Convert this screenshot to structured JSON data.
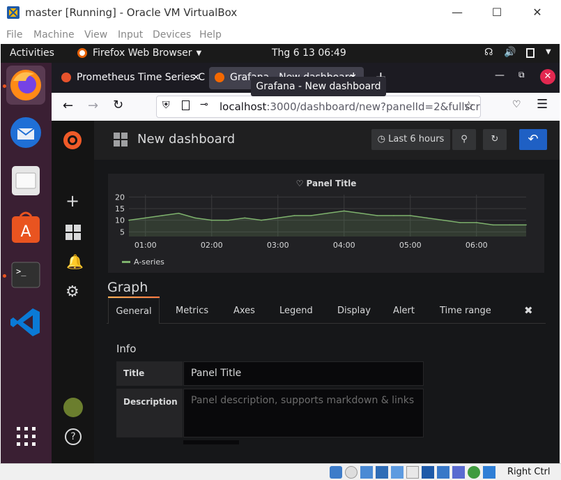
{
  "vbox": {
    "title": "master [Running] - Oracle VM VirtualBox",
    "menu": [
      "File",
      "Machine",
      "View",
      "Input",
      "Devices",
      "Help"
    ],
    "host_key": "Right Ctrl"
  },
  "gnome": {
    "activities": "Activities",
    "app_name": "Firefox Web Browser",
    "clock": "Thg 6 13  06:49"
  },
  "firefox": {
    "tabs": [
      {
        "label": "Prometheus Time Series C"
      },
      {
        "label": "Grafana - New dashboard"
      }
    ],
    "tooltip": "Grafana - New dashboard",
    "url_host": "localhost",
    "url_rest": ":3000/dashboard/new?panelId=2&fullscr"
  },
  "grafana": {
    "dashboard_title": "New dashboard",
    "time_range": "Last 6 hours",
    "panel_title": "Panel Title",
    "editor_title": "Graph",
    "tabs": [
      "General",
      "Metrics",
      "Axes",
      "Legend",
      "Display",
      "Alert",
      "Time range"
    ],
    "info_heading": "Info",
    "title_label": "Title",
    "title_value": "Panel Title",
    "description_label": "Description",
    "description_placeholder": "Panel description, supports markdown & links"
  },
  "chart_data": {
    "type": "line",
    "title": "Panel Title",
    "x": [
      "00:45",
      "01:00",
      "01:15",
      "01:30",
      "01:45",
      "02:00",
      "02:15",
      "02:30",
      "02:45",
      "03:00",
      "03:15",
      "03:30",
      "03:45",
      "04:00",
      "04:15",
      "04:30",
      "04:45",
      "05:00",
      "05:15",
      "05:30",
      "05:45",
      "06:00",
      "06:15",
      "06:30",
      "06:45"
    ],
    "x_ticks": [
      "01:00",
      "02:00",
      "03:00",
      "04:00",
      "05:00",
      "06:00"
    ],
    "y_ticks": [
      5,
      10,
      15,
      20
    ],
    "ylim": [
      3,
      21
    ],
    "series": [
      {
        "name": "A-series",
        "color": "#7eb26d",
        "values": [
          10,
          11,
          12,
          13,
          11,
          10,
          10,
          11,
          10,
          11,
          12,
          12,
          13,
          14,
          13,
          12,
          12,
          12,
          11,
          10,
          9,
          9,
          8,
          8,
          8
        ]
      }
    ],
    "legend": "bottom-left",
    "grid": true
  }
}
